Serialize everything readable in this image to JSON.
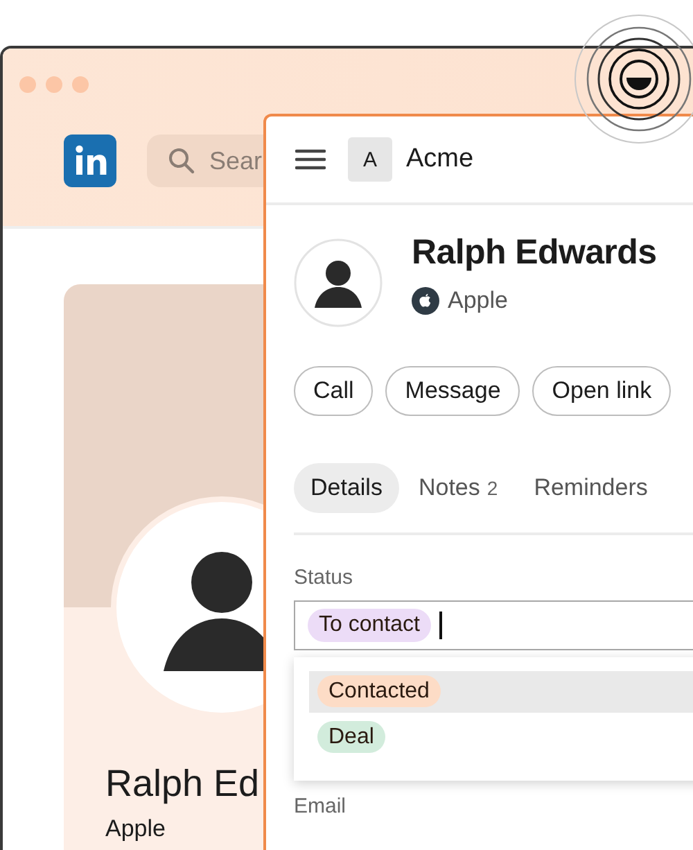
{
  "background_window": {
    "search": {
      "placeholder": "Sear"
    },
    "profile": {
      "name": "Ralph Ed",
      "company": "Apple"
    }
  },
  "panel": {
    "workspace": {
      "initial": "A",
      "name": "Acme"
    },
    "contact": {
      "name": "Ralph Edwards",
      "company": "Apple"
    },
    "actions": [
      "Call",
      "Message",
      "Open link"
    ],
    "tabs": [
      {
        "label": "Details",
        "selected": true
      },
      {
        "label": "Notes",
        "badge": "2",
        "selected": false
      },
      {
        "label": "Reminders",
        "selected": false
      }
    ],
    "status_field": {
      "label": "Status",
      "focused": true,
      "value": {
        "label": "To contact",
        "color": "#ecdcf7"
      }
    },
    "options": [
      {
        "label": "Contacted",
        "color": "#fddcc6",
        "selected": true
      },
      {
        "label": "Deal",
        "color": "#d2ecdc",
        "selected": false
      }
    ],
    "next_field_label": "Email"
  }
}
